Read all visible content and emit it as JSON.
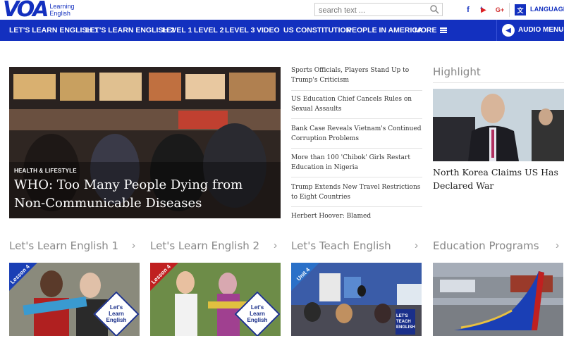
{
  "header": {
    "logo_mark": "VOA",
    "logo_sub": "Learning English",
    "search_placeholder": "search text ...",
    "languages_label": "LANGUAGES",
    "social": [
      "f",
      "t",
      "▶",
      "G+"
    ]
  },
  "nav": {
    "items": [
      "LET'S LEARN ENGLISH 1",
      "LET'S LEARN ENGLISH 2",
      "LEVEL 1",
      "LEVEL 2",
      "LEVEL 3",
      "VIDEO",
      "US CONSTITUTION",
      "PEOPLE IN AMERICA",
      "MORE"
    ],
    "audio_label": "AUDIO MENU"
  },
  "hero": {
    "category": "HEALTH & LIFESTYLE",
    "title": "WHO: Too Many People Dying from Non-Communicable Diseases"
  },
  "stories": [
    "Sports Officials, Players Stand Up to Trump's Criticism",
    "US Education Chief Cancels Rules on Sexual Assaults",
    "Bank Case Reveals Vietnam's Continued Corruption Problems",
    "More than 100 'Chibok' Girls Restart Education in Nigeria",
    "Trump Extends New Travel Restrictions to Eight Countries",
    "Herbert Hoover: Blamed"
  ],
  "highlight": {
    "heading": "Highlight",
    "title": "North Korea Claims US Has Declared War"
  },
  "sections": [
    {
      "title": "Let's Learn English 1",
      "lesson": "Lesson 4",
      "badge": "Let's Learn English"
    },
    {
      "title": "Let's Learn English 2",
      "lesson": "Lesson 4",
      "badge": "Let's Learn English"
    },
    {
      "title": "Let's Teach English",
      "lesson": "Unit 4",
      "badge": "LET'S TEACH ENGLISH"
    },
    {
      "title": "Education Programs",
      "lesson": "",
      "badge": ""
    }
  ],
  "colors": {
    "brand": "#1330bf",
    "nav_bg": "#1330bf",
    "section_heading": "#888888"
  }
}
